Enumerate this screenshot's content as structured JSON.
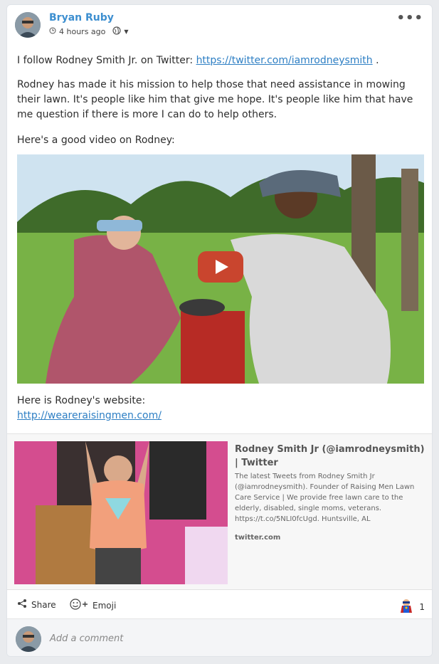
{
  "post": {
    "author": "Bryan Ruby",
    "time": "4 hours ago",
    "paragraphs": {
      "p1_prefix": "I follow Rodney Smith Jr. on Twitter: ",
      "p1_link": "https://twitter.com/iamrodneysmith",
      "p1_suffix": " .",
      "p2": "Rodney has made it his mission to help those that need assistance in mowing their lawn. It's people like him that give me hope. It's people like him that have me question if there is more I can do to help others.",
      "p3": "Here's a good video on Rodney:",
      "p4": "Here is Rodney's website:",
      "p4_link": "http://weareraisingmen.com/"
    }
  },
  "link_preview": {
    "title": "Rodney Smith Jr (@iamrodneysmith) | Twitter",
    "description": "The latest Tweets from Rodney Smith Jr (@iamrodneysmith). Founder of Raising Men Lawn Care Service | We provide free lawn care to the elderly, disabled, single moms, veterans. https://t.co/5NLI0fcUgd. Huntsville, AL",
    "domain": "twitter.com"
  },
  "actions": {
    "share": "Share",
    "emoji": "Emoji",
    "reaction_count": "1"
  },
  "comment": {
    "placeholder": "Add a comment"
  },
  "icons": {
    "more": "more-icon",
    "clock": "clock-icon",
    "visibility": "globe-icon",
    "play": "play-icon",
    "share": "share-icon",
    "emoji": "emoji-icon",
    "reaction": "superhero-icon"
  },
  "colors": {
    "author": "#3d8fd0",
    "link": "#2e7fc4",
    "play_button": "#c9452e"
  }
}
